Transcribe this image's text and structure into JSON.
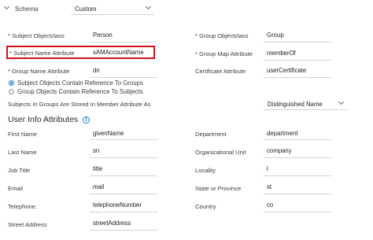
{
  "schema": {
    "label": "Schema",
    "value": "Custom"
  },
  "left_fields": [
    {
      "label": "* Subject Objectclass",
      "value": "Person"
    },
    {
      "label": "* Subject Name Attribute",
      "value": "sAMAccountName"
    },
    {
      "label": "* Group Name Attribute",
      "value": "dn"
    }
  ],
  "right_fields": [
    {
      "label": "* Group Objectclass",
      "value": "Group"
    },
    {
      "label": "* Group Map Attribute",
      "value": "memberOf"
    },
    {
      "label": "Certificate Attribute",
      "value": "userCertificate"
    }
  ],
  "radio_options": [
    {
      "label": "Subject Objects Contain Reference To Groups",
      "selected": true
    },
    {
      "label": "Group Objects Contain Reference To Subjects",
      "selected": false
    }
  ],
  "member_attribute": {
    "label": "Subjects In Groups Are Stored In Member Attribute As",
    "value": "Distinguished Name"
  },
  "user_info": {
    "title": "User Info Attributes",
    "info_icon": "info-icon",
    "left": [
      {
        "label": "First Name",
        "value": "givenName"
      },
      {
        "label": "Last Name",
        "value": "sn"
      },
      {
        "label": "Job Title",
        "value": "title"
      },
      {
        "label": "Email",
        "value": "mail"
      },
      {
        "label": "Telephone",
        "value": "telephoneNumber"
      },
      {
        "label": "Street Address",
        "value": "streetAddress"
      }
    ],
    "right": [
      {
        "label": "Department",
        "value": "department"
      },
      {
        "label": "Organizational Unit",
        "value": "company"
      },
      {
        "label": "Locality",
        "value": "l"
      },
      {
        "label": "State or Province",
        "value": "st"
      },
      {
        "label": "Country",
        "value": "co"
      }
    ]
  },
  "colors": {
    "highlight": "#d1121b",
    "accent": "#1e7fd1"
  }
}
